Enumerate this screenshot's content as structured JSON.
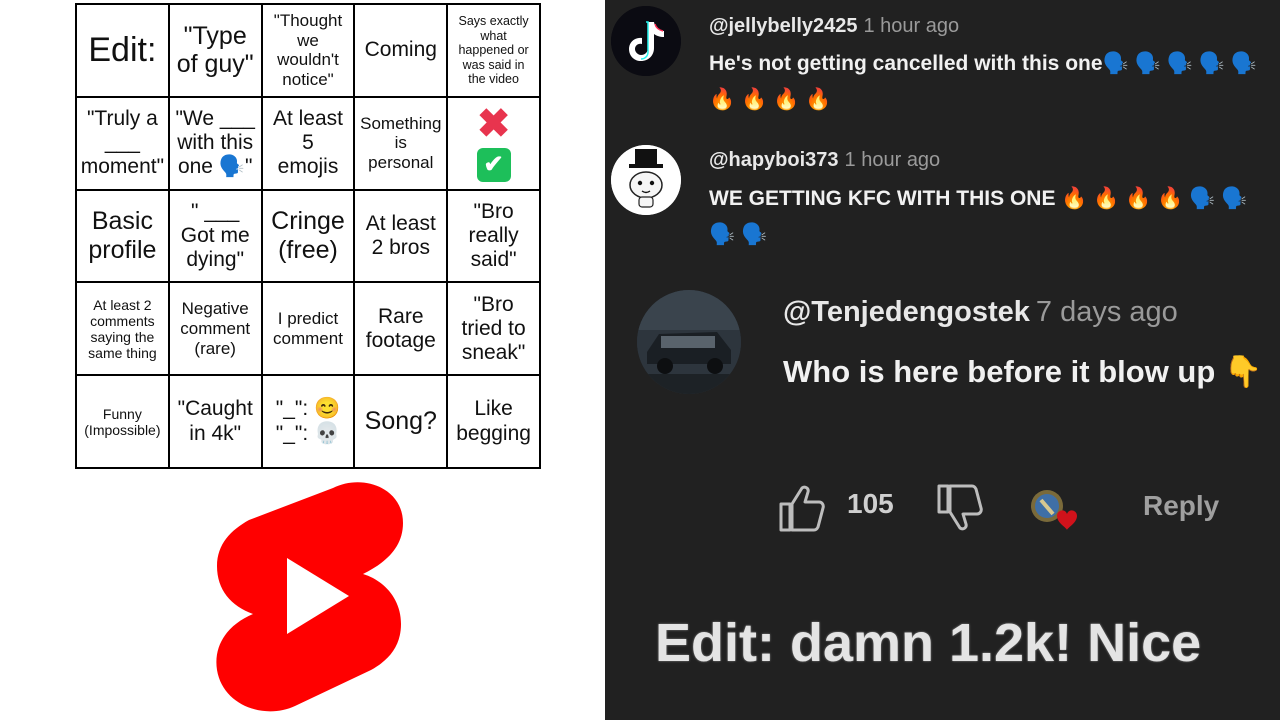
{
  "bingo": {
    "cells": [
      {
        "text": "Edit:",
        "size": "fs-xl"
      },
      {
        "text": "\"Type\nof guy\"",
        "size": "fs-l"
      },
      {
        "text": "\"Thought\nwe\nwouldn't\nnotice\"",
        "size": "fs-s"
      },
      {
        "text": "Coming",
        "size": "fs-m"
      },
      {
        "text": "Says exactly\nwhat\nhappened or\nwas said in\nthe video",
        "size": "fs-xxs"
      },
      {
        "text": "\"Truly a\n___\nmoment\"",
        "size": "fs-m"
      },
      {
        "text": "\"We ___\nwith this\none 🗣️\"",
        "size": "fs-m"
      },
      {
        "text": "At least\n5\nemojis",
        "size": "fs-m"
      },
      {
        "text": "Something\nis\npersonal",
        "size": "fs-s"
      },
      {
        "text": "",
        "size": "fs-m",
        "special": "cross-check"
      },
      {
        "text": "Basic\nprofile",
        "size": "fs-l"
      },
      {
        "text": "\" ___\nGot me\ndying\"",
        "size": "fs-m"
      },
      {
        "text": "Cringe\n(free)",
        "size": "fs-l"
      },
      {
        "text": "At least\n2 bros",
        "size": "fs-m"
      },
      {
        "text": "\"Bro\nreally\nsaid\"",
        "size": "fs-m"
      },
      {
        "text": "At least 2\ncomments\nsaying the\nsame thing",
        "size": "fs-xs"
      },
      {
        "text": "Negative\ncomment\n(rare)",
        "size": "fs-s"
      },
      {
        "text": "I predict\ncomment",
        "size": "fs-s"
      },
      {
        "text": "Rare\nfootage",
        "size": "fs-m"
      },
      {
        "text": "\"Bro\ntried to\nsneak\"",
        "size": "fs-m"
      },
      {
        "text": "Funny\n(Impossible)",
        "size": "fs-xs"
      },
      {
        "text": "\"Caught\nin 4k\"",
        "size": "fs-m"
      },
      {
        "text": "\"_\": 😊\n\"_\": 💀",
        "size": "fs-m"
      },
      {
        "text": "Song?",
        "size": "fs-l"
      },
      {
        "text": "Like\nbegging",
        "size": "fs-m"
      }
    ],
    "cross_icon": "✖",
    "check_icon": "✔"
  },
  "logo": {
    "name": "youtube-shorts-logo",
    "color": "#ff0000"
  },
  "comments": [
    {
      "handle": "@jellybelly2425",
      "time": "1 hour ago",
      "text": "He's not getting cancelled with this one🗣️ 🗣️ 🗣️ 🗣️ 🗣️ 🔥 🔥 🔥 🔥",
      "avatar": "tiktok-logo-avatar",
      "avatar_label": "TikTok"
    },
    {
      "handle": "@hapyboi373",
      "time": "1 hour ago",
      "text": "WE GETTING KFC WITH THIS ONE 🔥 🔥 🔥 🔥 🗣️ 🗣️ 🗣️ 🗣️",
      "avatar": "top-hat-cat-avatar"
    },
    {
      "handle": "@Tenjedengostek",
      "time": "7 days ago",
      "text": "Who is here before it blow up 👇",
      "avatar": "car-photo-avatar"
    }
  ],
  "actions": {
    "like_count": "105",
    "reply_label": "Reply"
  },
  "caption": "Edit: damn 1.2k! Nice",
  "colors": {
    "panel_bg": "#212121",
    "fire": "#ff6a00",
    "check_green": "#1dbf5a",
    "cross_red": "#e8344e"
  }
}
